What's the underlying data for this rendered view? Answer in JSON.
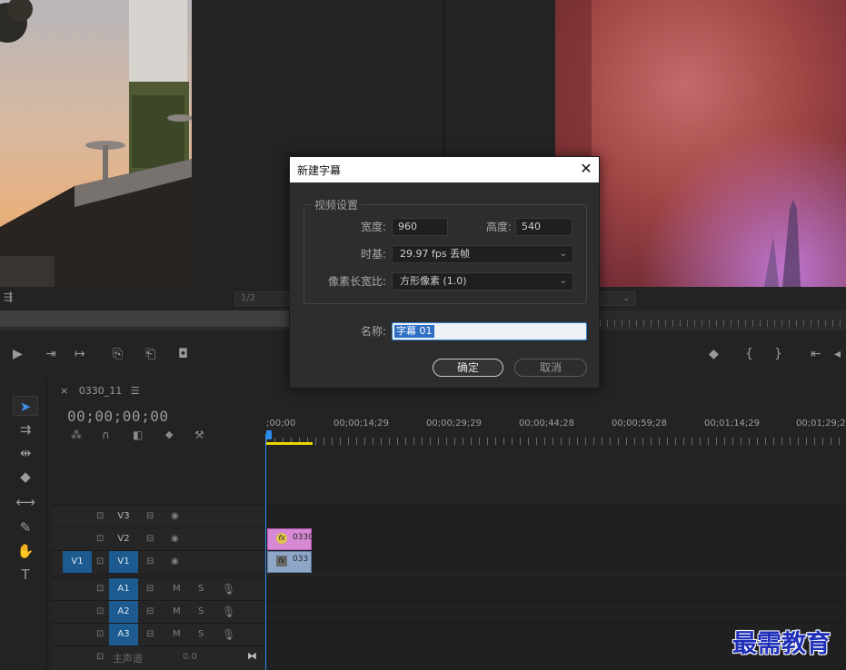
{
  "program_monitor": {
    "page_indicator": "1/2"
  },
  "sequence": {
    "tab_close": "×",
    "tab_name": "0330_11",
    "tab_menu": "☰",
    "timecode": "00;00;00;00",
    "ruler_labels": [
      ";00;00",
      "00;00;14;29",
      "00;00;29;29",
      "00;00;44;28",
      "00;00;59;28",
      "00;01;14;29",
      "00;01;29;29"
    ]
  },
  "tracks": {
    "video": [
      {
        "label": "V3",
        "source_patch": ""
      },
      {
        "label": "V2",
        "source_patch": ""
      },
      {
        "label": "V1",
        "source_patch": "V1"
      }
    ],
    "audio": [
      {
        "label": "A1",
        "m": "M",
        "s": "S"
      },
      {
        "label": "A2",
        "m": "M",
        "s": "S"
      },
      {
        "label": "A3",
        "m": "M",
        "s": "S"
      }
    ],
    "master": {
      "label": "主声道",
      "value": "0.0"
    }
  },
  "clips": {
    "v2": {
      "badge": "fx",
      "name": "0330"
    },
    "v1": {
      "badge": "fx",
      "name": "033"
    }
  },
  "dialog": {
    "title": "新建字幕",
    "close_glyph": "✕",
    "group_label": "视频设置",
    "width_label": "宽度:",
    "width_value": "960",
    "height_label": "高度:",
    "height_value": "540",
    "timebase_label": "时基:",
    "timebase_value": "29.97 fps 丢帧",
    "pixel_aspect_label": "像素长宽比:",
    "pixel_aspect_value": "方形像素 (1.0)",
    "name_label": "名称:",
    "name_value": "字幕 01",
    "ok_label": "确定",
    "cancel_label": "取消"
  },
  "watermark": "最需教育",
  "colors": {
    "track_active": "#1c5a8f",
    "playhead": "#2d8ceb",
    "clip_title": "#d789d5",
    "clip_video": "#8ea7c9",
    "in_out_bar": "#e6d800",
    "watermark": "#1f2fb8"
  }
}
